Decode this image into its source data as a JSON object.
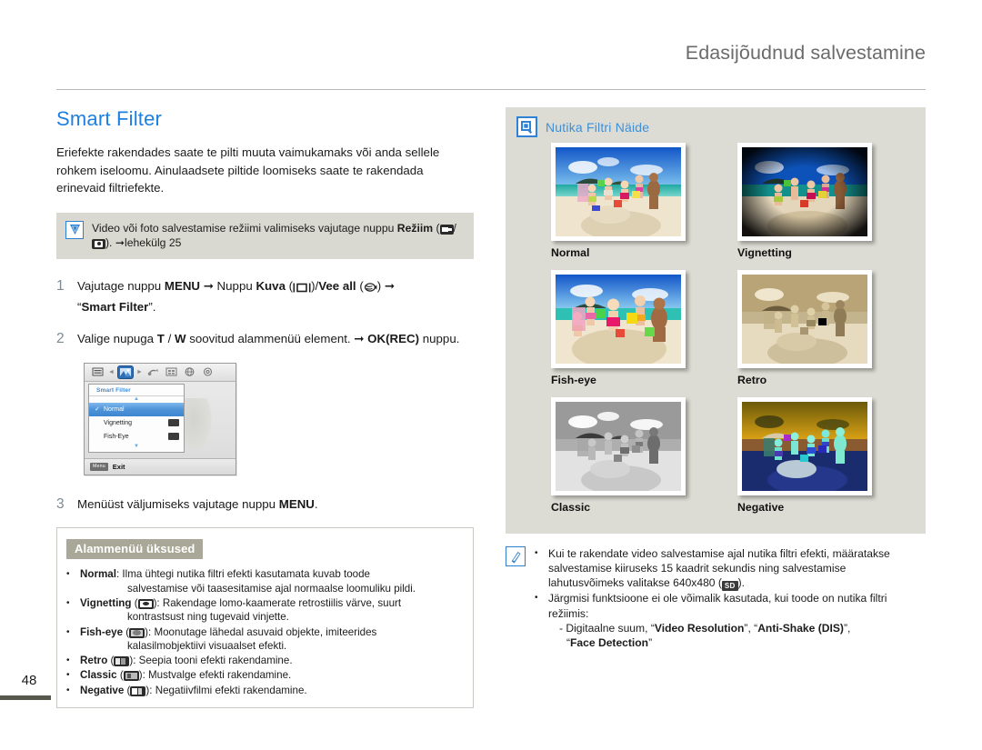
{
  "header": {
    "title": "Edasijõudnud salvestamine"
  },
  "page_number": "48",
  "left": {
    "heading": "Smart Filter",
    "intro": "Eriefekte rakendades saate te pilti muuta vaimukamaks või anda sellele rohkem iseloomu. Ainulaadsete piltide loomiseks saate te rakendada erinevaid filtriefekte.",
    "note": {
      "icon": "mode-check-icon",
      "text_1": "Video või foto salvestamise režiimi valimiseks vajutage nuppu ",
      "bold_1": "Režiim",
      "text_2": " (",
      "text_3": "/",
      "text_4": "). ➞lehekülg 25"
    },
    "steps": [
      {
        "number": "1",
        "part_1": "Vajutage nuppu ",
        "bold_1": "MENU",
        "part_2": " ➞ Nuppu ",
        "bold_2": "Kuva",
        "part_3": " (",
        "part_4": ")/",
        "bold_3": "Vee all",
        "part_5": " (",
        "part_6": ") ➞",
        "part_7": "“",
        "bold_4": "Smart Filter",
        "part_8": "”."
      },
      {
        "number": "2",
        "part_1": "Valige nupuga ",
        "bold_1": "T",
        "part_2": " / ",
        "bold_2": "W",
        "part_3": " soovitud alammenüü element. ➞ ",
        "bold_3": "OK(REC)",
        "part_4": " nuppu."
      },
      {
        "number": "3",
        "part_1": "Menüüst väljumiseks vajutage nuppu ",
        "bold_1": "MENU",
        "part_2": "."
      }
    ],
    "lcd": {
      "tabs": [
        "menu-list-icon",
        "display-image-icon",
        "audio-icon",
        "settings-grid-icon",
        "globe-icon",
        "gear-icon"
      ],
      "selected_tab_index": 1,
      "title": "Smart Filter",
      "rows": [
        {
          "label": "Normal",
          "checked": true,
          "badge": false
        },
        {
          "label": "Vignetting",
          "checked": false,
          "badge": true
        },
        {
          "label": "Fish-Eye",
          "checked": false,
          "badge": true
        }
      ],
      "menu_key": "Menu",
      "exit_label": "Exit"
    },
    "submenu": {
      "title": "Alammenüü üksused",
      "items": [
        {
          "name": "Normal",
          "has_icon": false,
          "desc": ": Ilma ühtegi nutika filtri efekti kasutamata kuvab toode",
          "cont": "salvestamise või taasesitamise ajal normaalse loomuliku pildi."
        },
        {
          "name": "Vignetting",
          "has_icon": true,
          "desc": "): Rakendage lomo-kaamerate retrostiilis värve, suurt",
          "cont": "kontrastsust ning tugevaid vinjette."
        },
        {
          "name": "Fish-eye",
          "has_icon": true,
          "desc": "): Moonutage lähedal asuvaid objekte, imiteerides",
          "cont": "kalasilmobjektiivi visuaalset efekti."
        },
        {
          "name": "Retro",
          "has_icon": true,
          "desc": "): Seepia tooni efekti rakendamine.",
          "cont": ""
        },
        {
          "name": "Classic",
          "has_icon": true,
          "desc": "): Mustvalge efekti rakendamine.",
          "cont": ""
        },
        {
          "name": "Negative",
          "has_icon": true,
          "desc": "): Negatiivfilmi efekti rakendamine.",
          "cont": ""
        }
      ],
      "paren_open": " ("
    }
  },
  "right": {
    "examples": {
      "icon": "magnifier-icon",
      "title": "Nutika Filtri Näide",
      "items": [
        {
          "label": "Normal",
          "filter": "normal"
        },
        {
          "label": "Vignetting",
          "filter": "vignetting"
        },
        {
          "label": "Fish-eye",
          "filter": "fisheye"
        },
        {
          "label": "Retro",
          "filter": "retro"
        },
        {
          "label": "Classic",
          "filter": "classic"
        },
        {
          "label": "Negative",
          "filter": "negative"
        }
      ]
    },
    "note": {
      "icon": "pencil-note-icon",
      "bullets": [
        {
          "text_1": "Kui te rakendate video salvestamise ajal nutika filtri efekti, määratakse salvestamise kiiruseks 15 kaadrit sekundis ning salvestamise lahutusvõimeks valitakse 640x480 (",
          "chip": "SD",
          "text_2": ")."
        },
        {
          "text_1": "Järgmisi funktsioone ei ole võimalik kasutada, kui toode on nutika filtri režiimis:",
          "dash_1": "- Digitaalne suum, “",
          "bold_1": "Video Resolution",
          "dash_2": "”, “",
          "bold_2": "Anti-Shake (DIS)",
          "dash_3": "”,",
          "dash_4": "“",
          "bold_3": "Face Detection",
          "dash_5": "”"
        }
      ]
    }
  },
  "colors": {
    "accent_blue": "#1f7fe0",
    "header_gray": "#6b6b6b",
    "note_bg": "#d9d9d1",
    "example_bg": "#dcdcd4",
    "submenu_header_bg": "#a9a898",
    "page_bar": "#55584a"
  }
}
